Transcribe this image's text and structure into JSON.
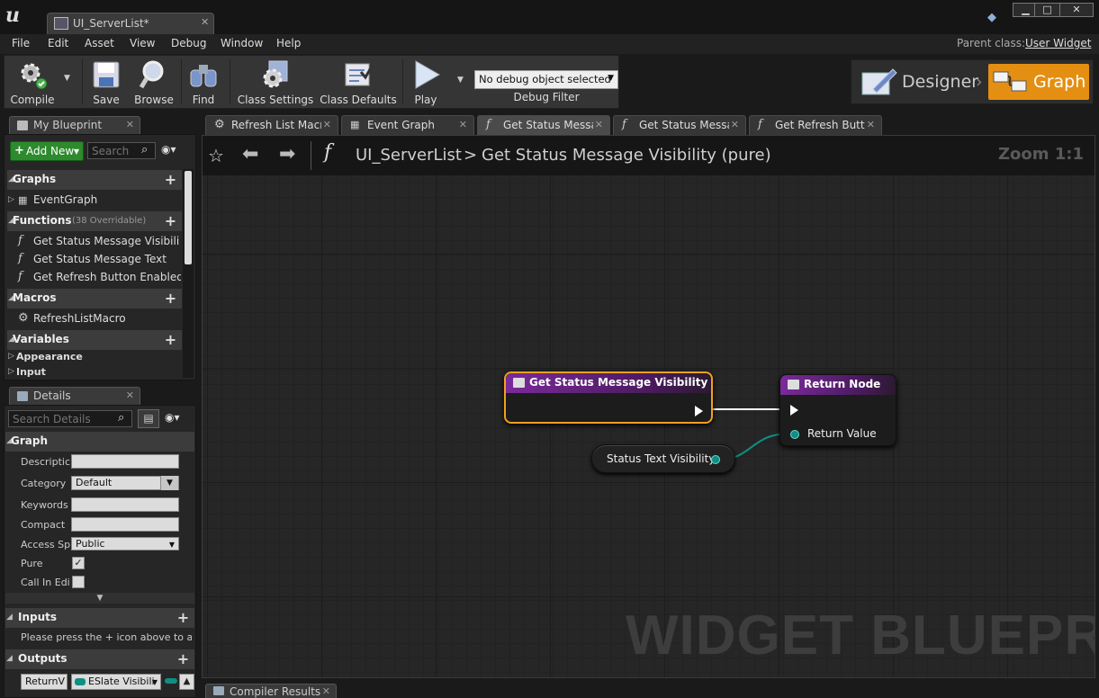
{
  "window": {
    "document_tab": "UI_ServerList*",
    "minimize": "▁",
    "maximize": "□",
    "close": "✕"
  },
  "menu": [
    "File",
    "Edit",
    "Asset",
    "View",
    "Debug",
    "Window",
    "Help"
  ],
  "parent_class": {
    "label": "Parent class:",
    "value": "User Widget"
  },
  "toolbar": {
    "compile": "Compile",
    "save": "Save",
    "browse": "Browse",
    "find": "Find",
    "class_settings": "Class Settings",
    "class_defaults": "Class Defaults",
    "play": "Play",
    "debug_select": "No debug object selected",
    "debug_filter": "Debug Filter"
  },
  "modes": {
    "designer": "Designer",
    "graph": "Graph"
  },
  "my_blueprint": {
    "tab": "My Blueprint",
    "add_new": "Add New",
    "search_placeholder": "Search",
    "graphs_header": "Graphs",
    "graphs": [
      "EventGraph"
    ],
    "functions_header": "Functions",
    "functions_overridable": "(38 Overridable)",
    "functions": [
      "Get Status Message Visibili",
      "Get Status Message Text",
      "Get Refresh Button Enabled"
    ],
    "macros_header": "Macros",
    "macros": [
      "RefreshListMacro"
    ],
    "variables_header": "Variables",
    "variables": [
      "Appearance",
      "Input"
    ]
  },
  "details": {
    "tab": "Details",
    "search_placeholder": "Search Details",
    "graph_header": "Graph",
    "rows": {
      "description": "Descriptic",
      "category": "Category",
      "category_value": "Default",
      "keywords": "Keywords",
      "compact": "Compact",
      "access": "Access Sp",
      "access_value": "Public",
      "pure": "Pure",
      "call_in_editor": "Call In Edi"
    },
    "inputs_header": "Inputs",
    "inputs_hint": "Please press the + icon above to ad",
    "outputs_header": "Outputs",
    "output_name": "ReturnV",
    "output_type": "ESlate Visibili"
  },
  "graph_tabs": [
    "Refresh List Macro",
    "Event Graph",
    "Get Status Messag",
    "Get Status Messag",
    "Get Refresh Button"
  ],
  "breadcrumb": {
    "root": "UI_ServerList",
    "sep": ">",
    "current": "Get Status Message Visibility (pure)"
  },
  "zoom": "Zoom 1:1",
  "watermark": "WIDGET BLUEPRINT",
  "nodes": {
    "entry": "Get Status Message Visibility",
    "return": "Return Node",
    "return_value": "Return Value",
    "variable": "Status Text Visibility"
  },
  "compiler_tab": "Compiler Results",
  "colors": {
    "accent": "#e48f12",
    "function_header": "#7a2a9a",
    "pin": "#0f8f85",
    "selection": "#f0a020"
  }
}
